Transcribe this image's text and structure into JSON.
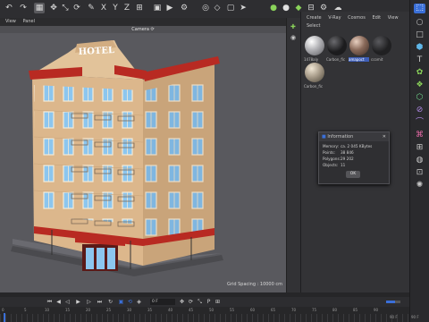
{
  "viewport": {
    "menu": [
      "View",
      "Panel"
    ],
    "camera_label": "Camera",
    "camera_chevron": "⟳",
    "grid_spacing": "Grid Spacing : 10000 cm",
    "building_sign": "HOTEL"
  },
  "material_manager": {
    "menu": [
      "Create",
      "V-Ray",
      "Cosmos",
      "Edit",
      "View",
      "Select"
    ],
    "materials": [
      {
        "label": "1478aly",
        "color": "#c9c9cc"
      },
      {
        "label": "Carbon_fic",
        "color": "#1e1e20"
      },
      {
        "label": "amapoct",
        "color": "#8a6a5a",
        "selected": true
      },
      {
        "label": "ccomit",
        "color": "#252527"
      },
      {
        "label": "Carbon_fic",
        "color": "#a89c8a"
      }
    ]
  },
  "info_dialog": {
    "title": "Information",
    "rows": [
      {
        "key": "Memory:",
        "value": "ca. 2 045 KBytes"
      },
      {
        "key": "Points:",
        "value": "38 846"
      },
      {
        "key": "Polygons:",
        "value": "29 202"
      },
      {
        "key": "Objects:",
        "value": "11"
      }
    ],
    "ok_label": "OK"
  },
  "timeline": {
    "current_frame": "0 F",
    "ticks": [
      "0",
      "5",
      "10",
      "15",
      "20",
      "25",
      "30",
      "35",
      "40",
      "45",
      "50",
      "55",
      "60",
      "65",
      "70",
      "75",
      "80",
      "85",
      "90"
    ],
    "end_frame_left": "90 F",
    "end_frame_right": "90 F"
  },
  "colors": {
    "accent": "#3a6fd8",
    "viewport_bg": "#59595e",
    "building_wall": "#d8b48a",
    "building_trim": "#b82a22"
  }
}
